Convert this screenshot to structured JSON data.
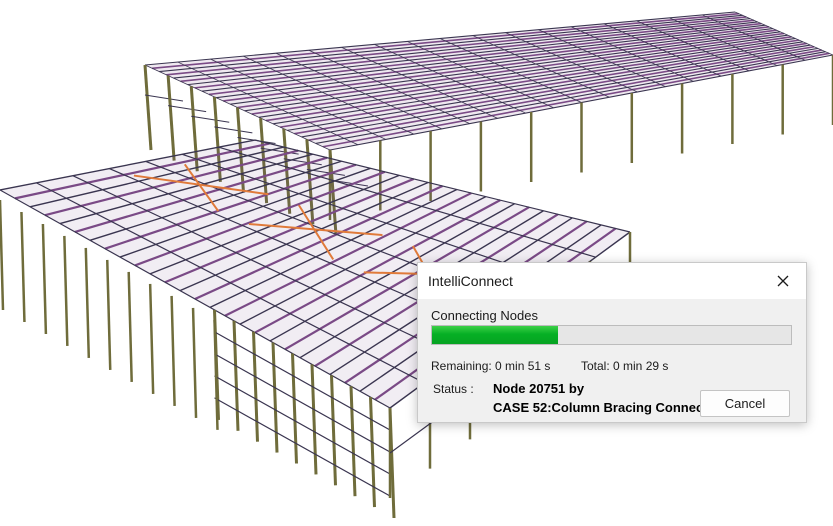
{
  "dialog": {
    "title": "IntelliConnect",
    "operation": "Connecting Nodes",
    "progress_fraction": 0.35,
    "remaining": "Remaining: 0 min 51 s",
    "total": "Total: 0 min 29 s",
    "status_label": "Status :",
    "status_line1": "Node 20751 by",
    "status_line2": "CASE 52:Column Bracing Connection",
    "cancel_label": "Cancel",
    "close_icon": "close-icon"
  },
  "colors": {
    "roof_purple": "#7a4a86",
    "column_olive": "#6f6c3b",
    "bracing_orange": "#e07a3a",
    "beam_dark": "#3a3550",
    "progress_green": "#06b025"
  }
}
